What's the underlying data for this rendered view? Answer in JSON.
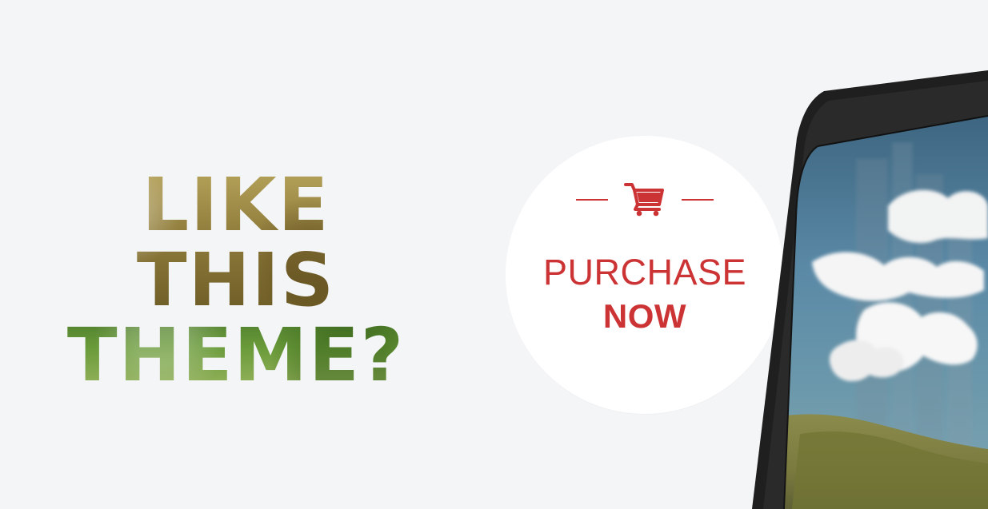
{
  "headline": {
    "line1": "LIKE THIS",
    "line2": "THEME?"
  },
  "purchase": {
    "line1": "PURCHASE",
    "line2": "NOW",
    "icon": "cart-icon",
    "accent_color": "#cc3334"
  },
  "tablet": {
    "screen_image": "tablet-screen-image"
  },
  "colors": {
    "background": "#f4f5f7",
    "accent": "#cc3334",
    "circle": "#ffffff",
    "tablet_body": "#1f1f1f"
  }
}
